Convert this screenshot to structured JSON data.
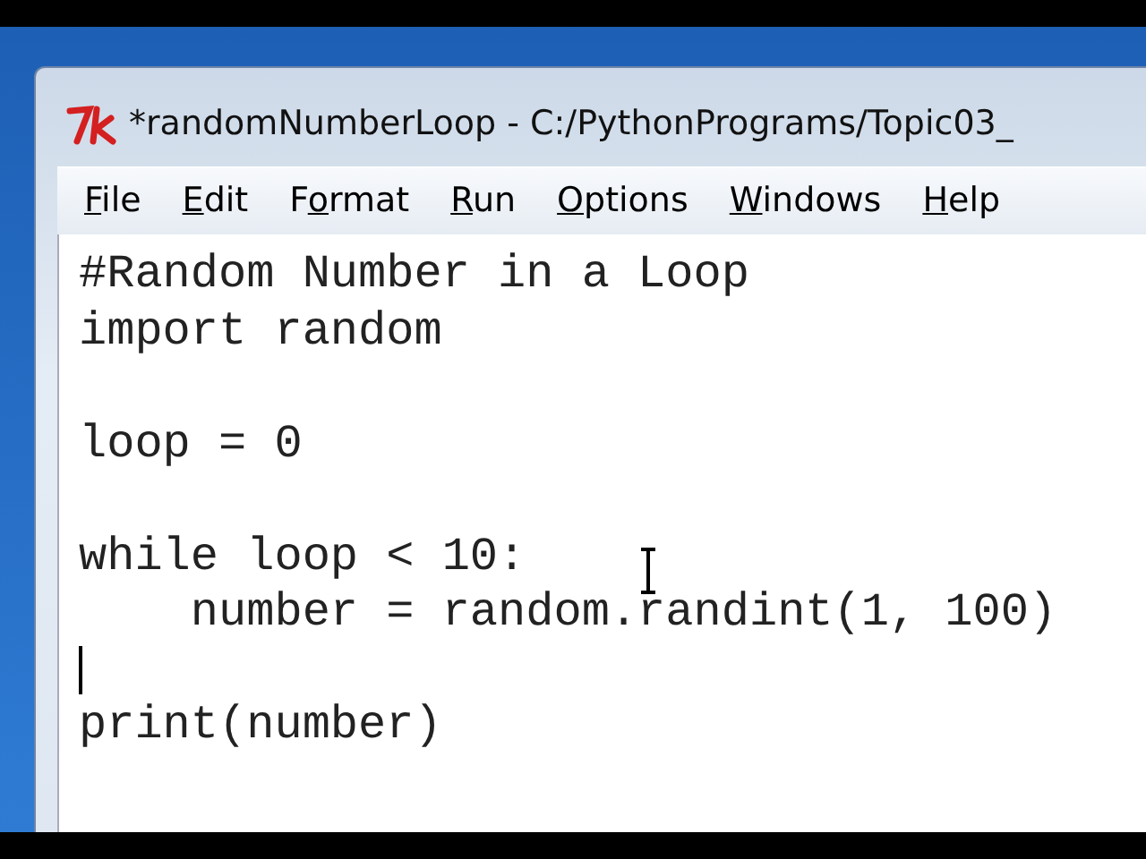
{
  "window": {
    "title": "*randomNumberLoop - C:/PythonPrograms/Topic03_"
  },
  "menu": [
    {
      "parts": [
        {
          "text": "F",
          "underlined": true
        },
        {
          "text": "ile",
          "underlined": false
        }
      ]
    },
    {
      "parts": [
        {
          "text": "E",
          "underlined": true
        },
        {
          "text": "dit",
          "underlined": false
        }
      ]
    },
    {
      "parts": [
        {
          "text": "F",
          "underlined": false
        },
        {
          "text": "o",
          "underlined": true
        },
        {
          "text": "rmat",
          "underlined": false
        }
      ]
    },
    {
      "parts": [
        {
          "text": "R",
          "underlined": true
        },
        {
          "text": "un",
          "underlined": false
        }
      ]
    },
    {
      "parts": [
        {
          "text": "O",
          "underlined": true
        },
        {
          "text": "ptions",
          "underlined": false
        }
      ]
    },
    {
      "parts": [
        {
          "text": "W",
          "underlined": true
        },
        {
          "text": "indows",
          "underlined": false
        }
      ]
    },
    {
      "parts": [
        {
          "text": "H",
          "underlined": true
        },
        {
          "text": "elp",
          "underlined": false
        }
      ]
    }
  ],
  "editor": {
    "lines": [
      {
        "kind": "code",
        "text": "#Random Number in a Loop",
        "caret": false
      },
      {
        "kind": "code",
        "text": "import random",
        "caret": false
      },
      {
        "kind": "blank",
        "caret": false
      },
      {
        "kind": "code",
        "text": "loop = 0",
        "caret": false
      },
      {
        "kind": "blank",
        "caret": false
      },
      {
        "kind": "code",
        "text": "while loop < 10:",
        "caret": false
      },
      {
        "kind": "code",
        "text": "    number = random.randint(1, 100)",
        "caret": false
      },
      {
        "kind": "blank",
        "caret": true
      },
      {
        "kind": "code",
        "text": "print(number)",
        "caret": false
      }
    ]
  }
}
